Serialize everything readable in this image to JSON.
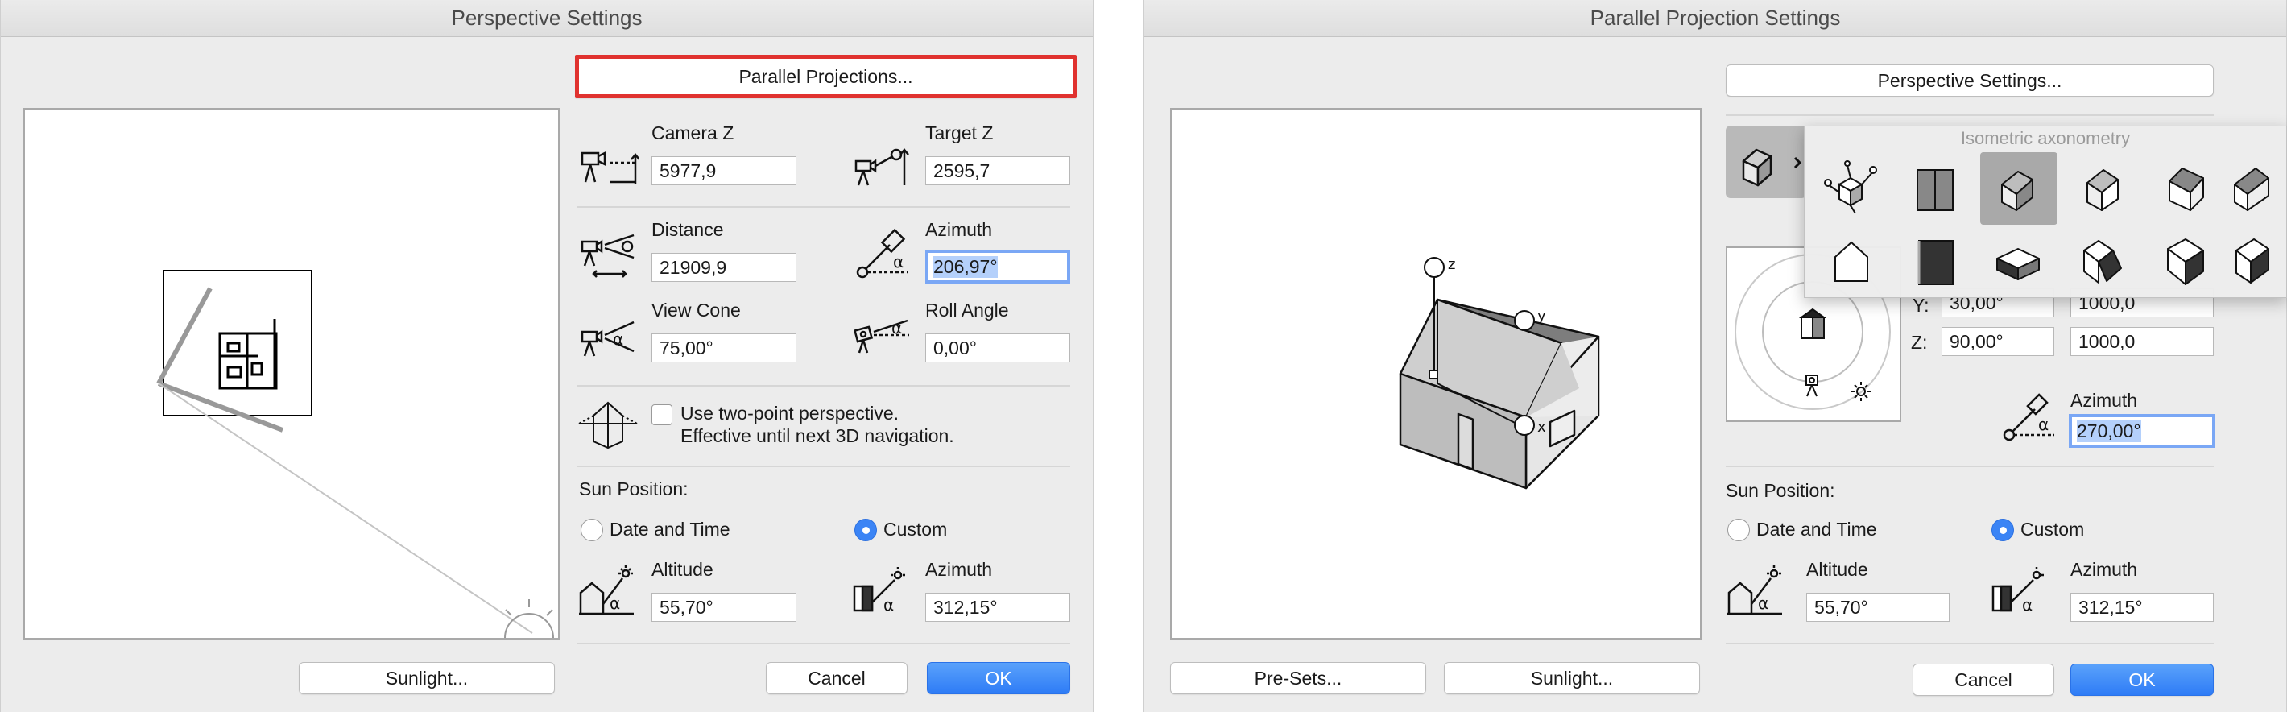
{
  "persp": {
    "title": "Perspective Settings",
    "parallel_button": "Parallel Projections...",
    "camera_z_label": "Camera Z",
    "camera_z_value": "5977,9",
    "target_z_label": "Target Z",
    "target_z_value": "2595,7",
    "distance_label": "Distance",
    "distance_value": "21909,9",
    "azimuth_label": "Azimuth",
    "azimuth_value": "206,97°",
    "view_cone_label": "View Cone",
    "view_cone_value": "75,00°",
    "roll_angle_label": "Roll Angle",
    "roll_angle_value": "0,00°",
    "two_point_line1": "Use two-point perspective.",
    "two_point_line2": "Effective until next 3D navigation.",
    "sun_position_label": "Sun Position:",
    "date_time_label": "Date and Time",
    "custom_label": "Custom",
    "altitude_label": "Altitude",
    "altitude_value": "55,70°",
    "sun_azimuth_label": "Azimuth",
    "sun_azimuth_value": "312,15°",
    "sunlight_button": "Sunlight...",
    "cancel_button": "Cancel",
    "ok_button": "OK"
  },
  "parallel": {
    "title": "Parallel Projection Settings",
    "perspective_button": "Perspective Settings...",
    "popup_title": "Isometric axonometry",
    "y_label": "Y:",
    "y_angle": "30,00°",
    "y_length": "1000,0",
    "z_label": "Z:",
    "z_angle": "90,00°",
    "z_length": "1000,0",
    "azimuth_label": "Azimuth",
    "azimuth_value": "270,00°",
    "sun_position_label": "Sun Position:",
    "date_time_label": "Date and Time",
    "custom_label": "Custom",
    "altitude_label": "Altitude",
    "altitude_value": "55,70°",
    "sun_azimuth_label": "Azimuth",
    "sun_azimuth_value": "312,15°",
    "presets_button": "Pre-Sets...",
    "sunlight_button": "Sunlight...",
    "cancel_button": "Cancel",
    "ok_button": "OK",
    "axis_x": "x",
    "axis_y": "y",
    "axis_z": "z"
  },
  "colors": {
    "accent": "#2e7cf6",
    "highlight": "#e0322f",
    "focus_ring": "#7aa7f5"
  }
}
